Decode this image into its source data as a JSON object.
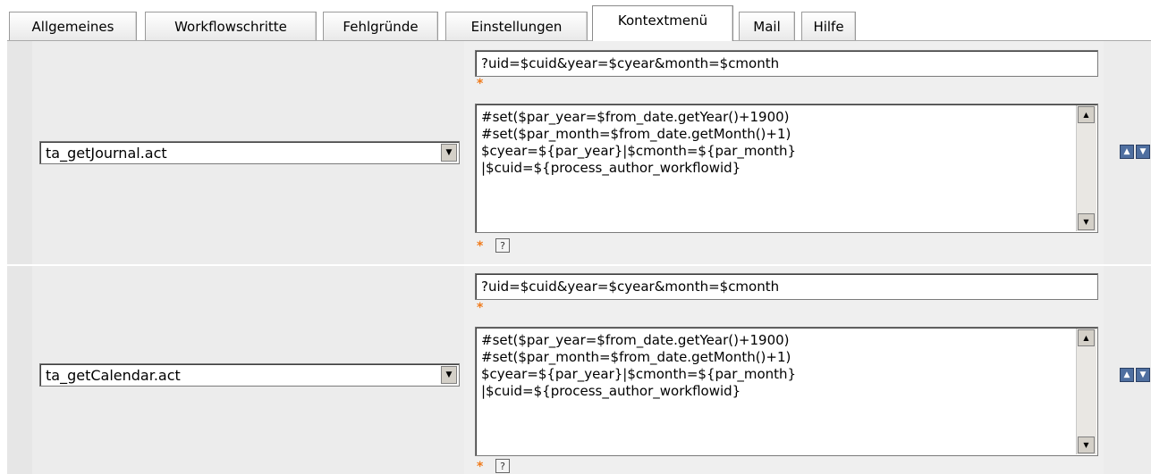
{
  "tabs": [
    {
      "label": "Allgemeines"
    },
    {
      "label": "Workflowschritte"
    },
    {
      "label": "Fehlgründe"
    },
    {
      "label": "Einstellungen"
    },
    {
      "label": "Kontextmenü"
    },
    {
      "label": "Mail"
    },
    {
      "label": "Hilfe"
    }
  ],
  "active_tab": "Kontextmenü",
  "rows": [
    {
      "action_select": "ta_getJournal.act",
      "params_input": "?uid=$cuid&year=$cyear&month=$cmonth",
      "script": "#set($par_year=$from_date.getYear()+1900)\n#set($par_month=$from_date.getMonth()+1)\n$cyear=${par_year}|$cmonth=${par_month}\n|$cuid=${process_author_workflowid}",
      "required_mark": "*",
      "help_label": "?"
    },
    {
      "action_select": "ta_getCalendar.act",
      "params_input": "?uid=$cuid&year=$cyear&month=$cmonth",
      "script": "#set($par_year=$from_date.getYear()+1900)\n#set($par_month=$from_date.getMonth()+1)\n$cyear=${par_year}|$cmonth=${par_month}\n|$cuid=${process_author_workflowid}",
      "required_mark": "*",
      "help_label": "?"
    }
  ],
  "colors": {
    "required_star": "#f07a1a",
    "move_buttons": "#4f6fa0"
  }
}
